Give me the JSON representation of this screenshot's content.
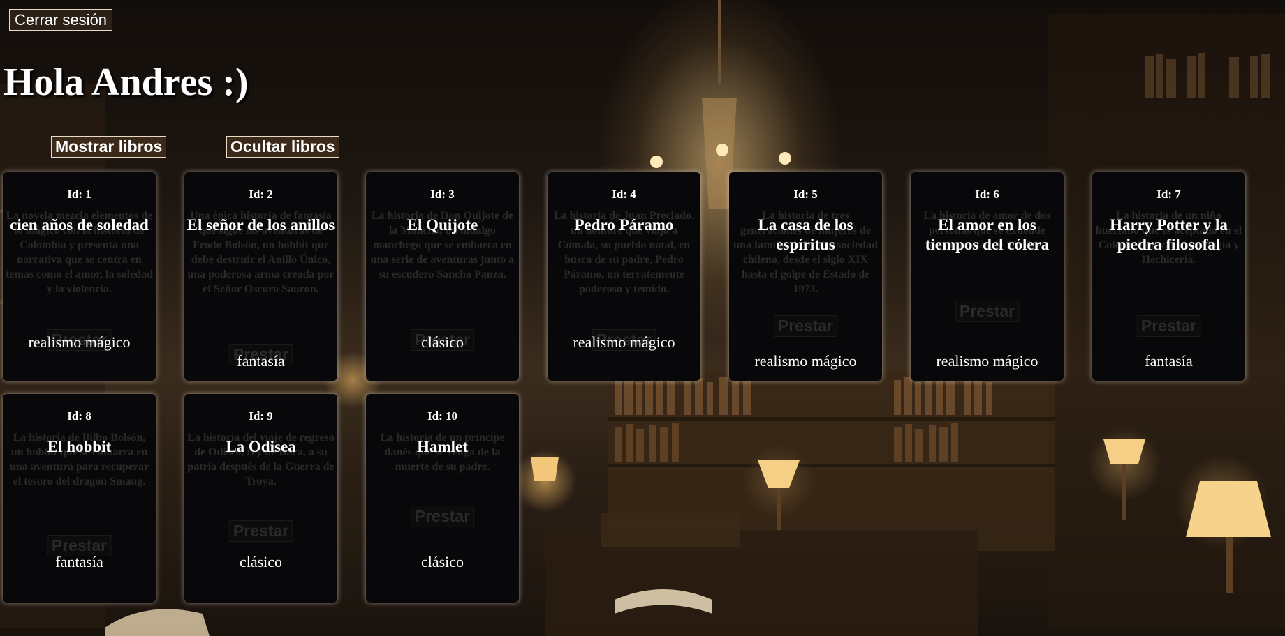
{
  "header": {
    "logout_label": "Cerrar sesión",
    "greeting": "Hola Andres :)"
  },
  "controls": {
    "show_label": "Mostrar libros",
    "hide_label": "Ocultar libros"
  },
  "lend_label": "Prestar",
  "books": [
    {
      "id_label": "Id: 1",
      "title": "cien años de soledad",
      "description": "La novela mezcla elementos de lo mágico con la historia de Colombia y presenta una narrativa que se centra en temas como el amor, la soledad y la violencia.",
      "genre": "realismo mágico"
    },
    {
      "id_label": "Id: 2",
      "title": "El señor de los anillos",
      "description": "Una épica historia de fantasía que sigue las aventuras de Frodo Bolsón, un hobbit que debe destruir el Anillo Único, una poderosa arma creada por el Señor Oscuro Sauron.",
      "genre": "fantasía"
    },
    {
      "id_label": "Id: 3",
      "title": "El Quijote",
      "description": "La historia de Don Quijote de la Mancha, un hidalgo manchego que se embarca en una serie de aventuras junto a su escudero Sancho Panza.",
      "genre": "clásico"
    },
    {
      "id_label": "Id: 4",
      "title": "Pedro Páramo",
      "description": "La historia de Juan Preciado, un hombre que viaja a Comala, su pueblo natal, en busca de su padre, Pedro Páramo, un terrateniente poderoso y temido.",
      "genre": "realismo mágico"
    },
    {
      "id_label": "Id: 5",
      "title": "La casa de los espíritus",
      "description": "La historia de tres generaciones de mujeres de una familia de la alta sociedad chilena, desde el siglo XIX hasta el golpe de Estado de 1973.",
      "genre": "realismo mágico"
    },
    {
      "id_label": "Id: 6",
      "title": "El amor en los tiempos del cólera",
      "description": "La historia de amor de dos personas que se extiende durante más de 50 años.",
      "genre": "realismo mágico"
    },
    {
      "id_label": "Id: 7",
      "title": "Harry Potter y la piedra filosofal",
      "description": "La historia de un niño huérfano que es aceptado en el Colegio Hogwarts de Magia y Hechicería.",
      "genre": "fantasía"
    },
    {
      "id_label": "Id: 8",
      "title": "El hobbit",
      "description": "La historia de Bilbo Bolsón, un hobbit que se embarca en una aventura para recuperar el tesoro del dragón Smaug.",
      "genre": "fantasía"
    },
    {
      "id_label": "Id: 9",
      "title": "La Odisea",
      "description": "La historia del viaje de regreso de Odiseo, rey de Ítaca, a su patria después de la Guerra de Troya.",
      "genre": "clásico"
    },
    {
      "id_label": "Id: 10",
      "title": "Hamlet",
      "description": "La historia de un príncipe danés que se venga de la muerte de su padre.",
      "genre": "clásico"
    }
  ]
}
